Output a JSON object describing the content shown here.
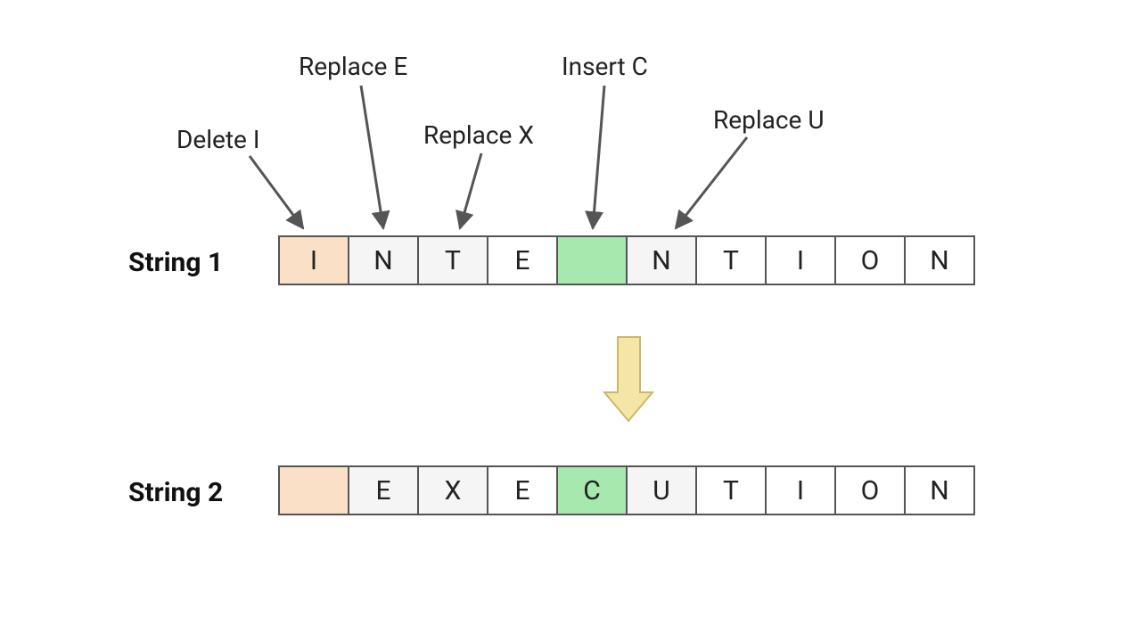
{
  "labels": {
    "row1": "String 1",
    "row2": "String 2"
  },
  "operations": {
    "op0": "Delete I",
    "op1": "Replace E",
    "op2": "Replace X",
    "op3": "Insert C",
    "op4": "Replace U"
  },
  "string1": {
    "c0": "I",
    "c1": "N",
    "c2": "T",
    "c3": "E",
    "c4": "",
    "c5": "N",
    "c6": "T",
    "c7": "I",
    "c8": "O",
    "c9": "N"
  },
  "string2": {
    "c0": "",
    "c1": "E",
    "c2": "X",
    "c3": "E",
    "c4": "C",
    "c5": "U",
    "c6": "T",
    "c7": "I",
    "c8": "O",
    "c9": "N"
  },
  "colors": {
    "peach": "#fbe0c8",
    "green": "#a7e8af",
    "lightgrey": "#f5f5f5",
    "arrow": "#555555",
    "downArrowFill": "#f5e6a8",
    "downArrowStroke": "#c9b96a"
  }
}
